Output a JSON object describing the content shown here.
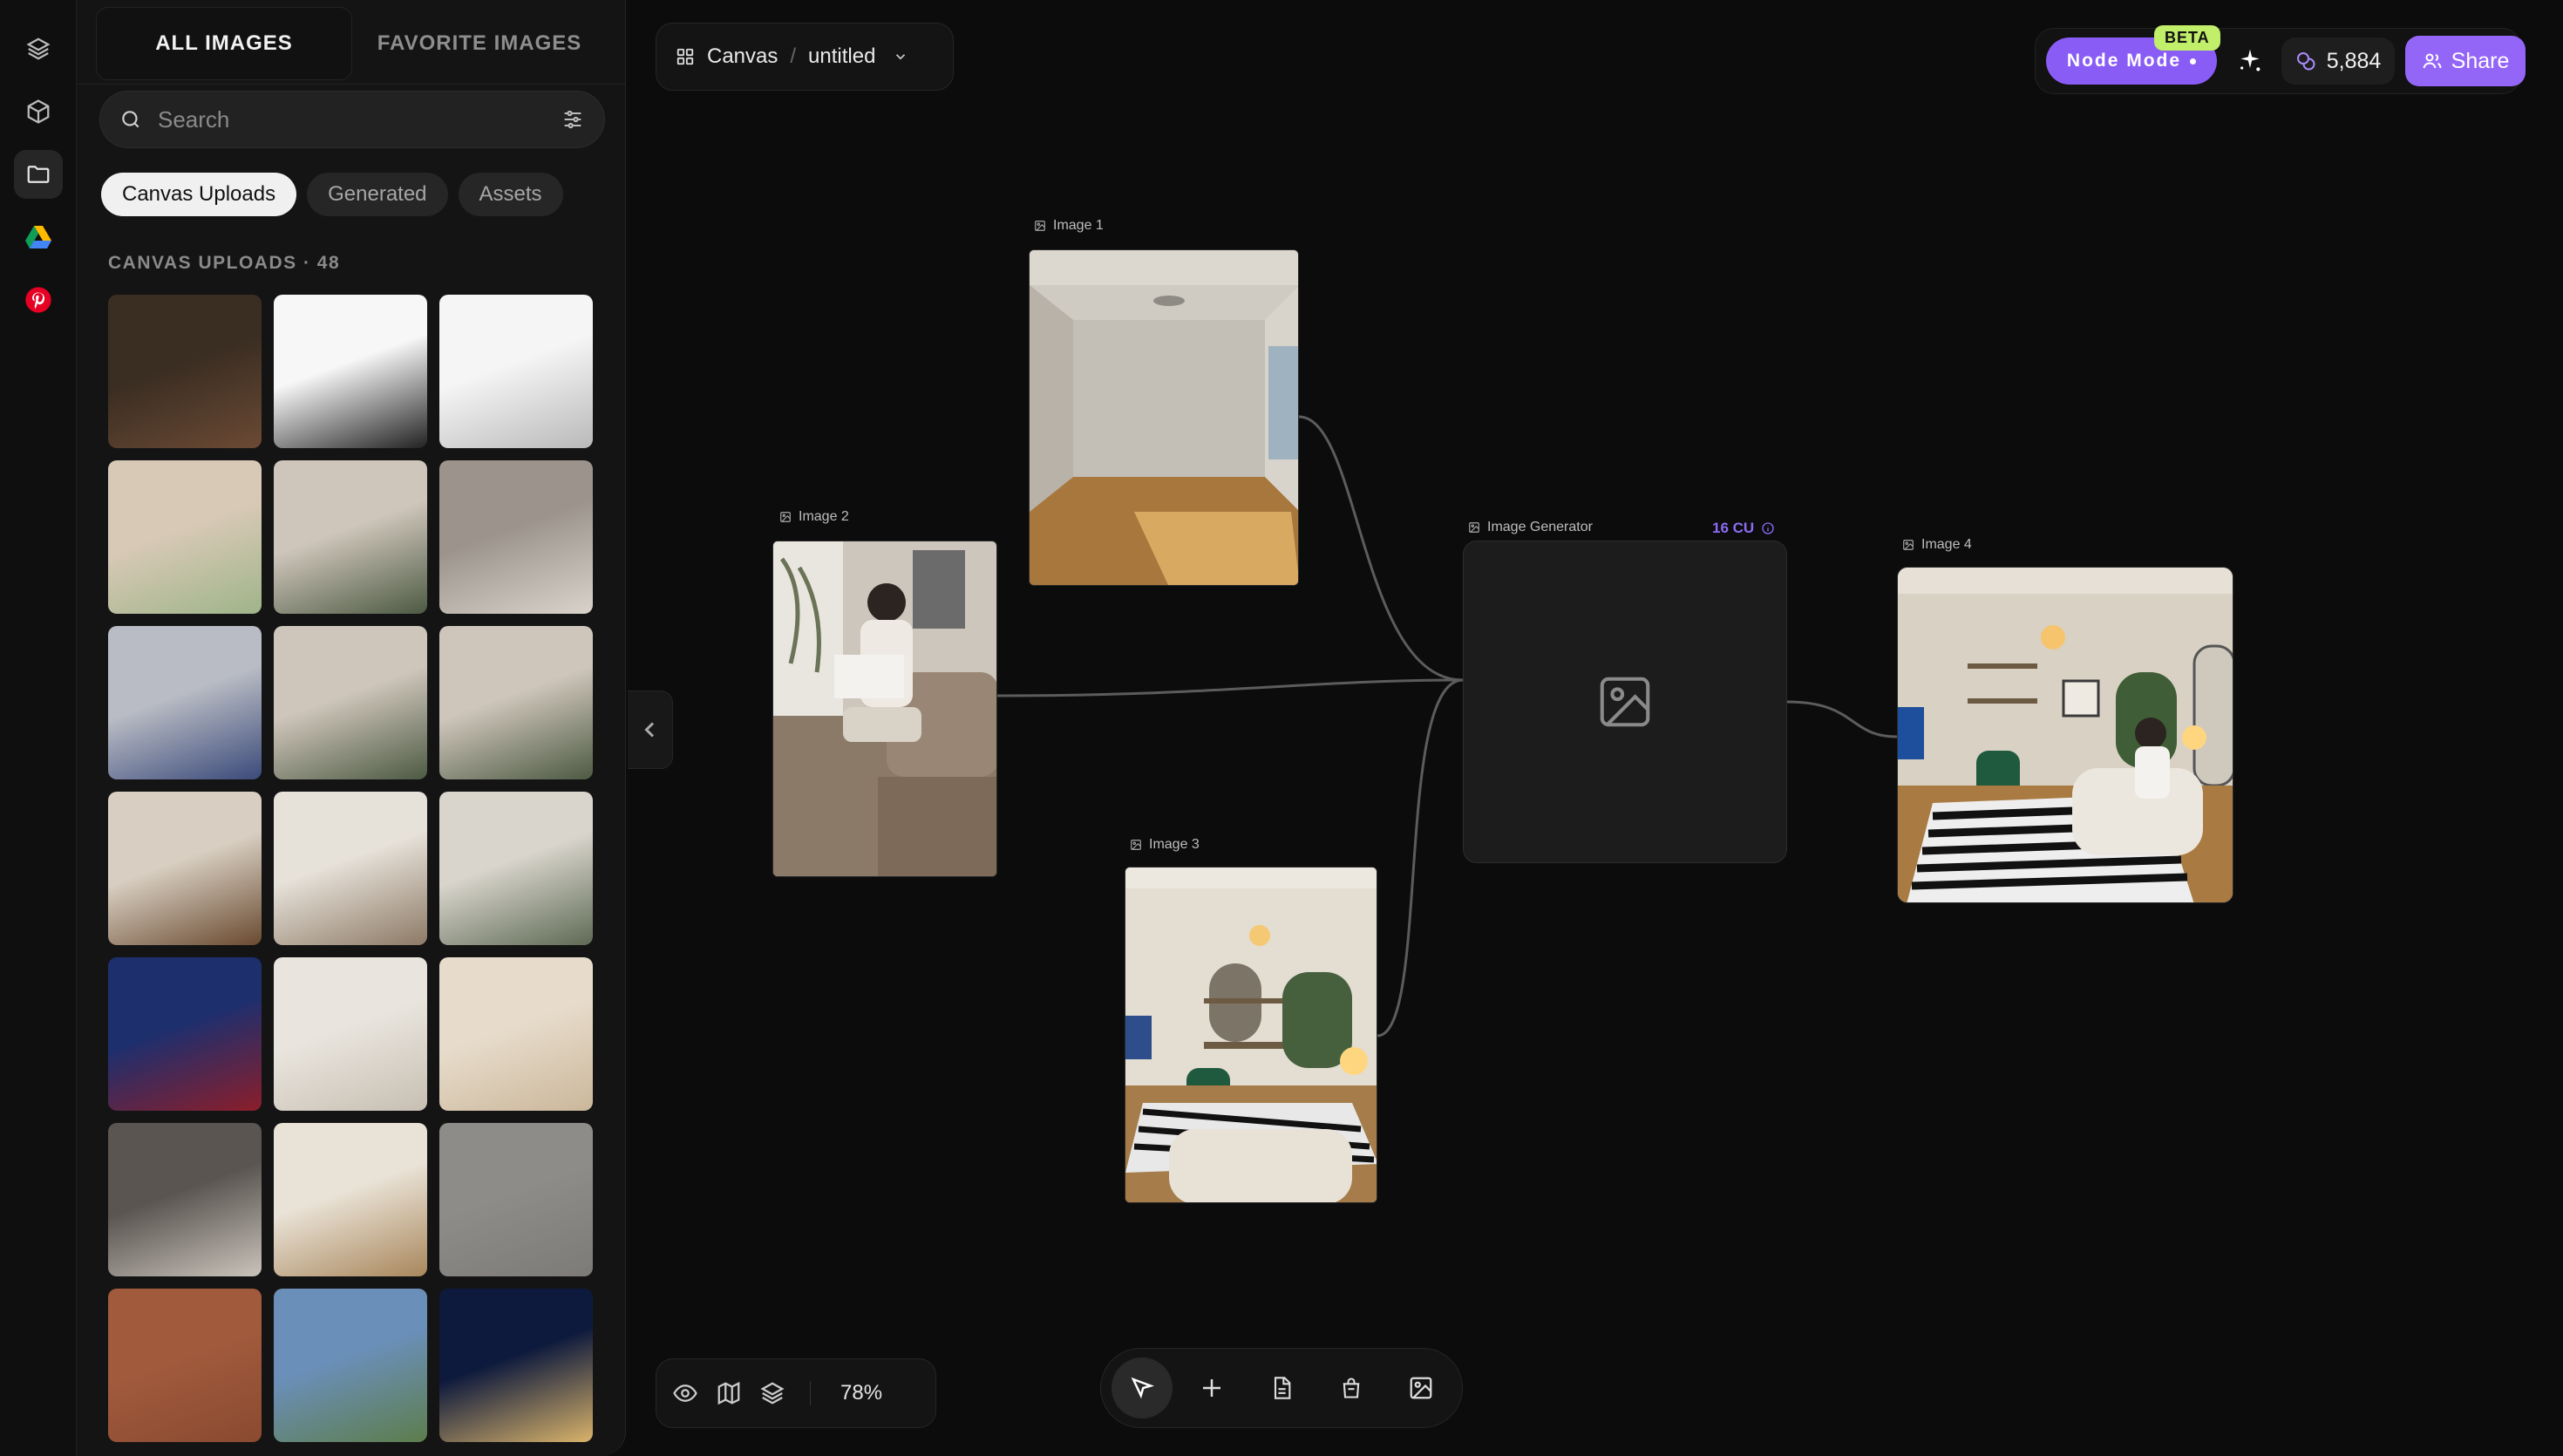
{
  "rail": {
    "items": [
      {
        "icon": "layers-icon"
      },
      {
        "icon": "cube-icon"
      },
      {
        "icon": "folder-icon"
      },
      {
        "icon": "google-drive-icon"
      },
      {
        "icon": "pinterest-icon"
      }
    ]
  },
  "sidebar": {
    "tabs": [
      "ALL IMAGES",
      "FAVORITE IMAGES"
    ],
    "search_placeholder": "Search",
    "chips": [
      "Canvas Uploads",
      "Generated",
      "Assets"
    ],
    "section_label": "CANVAS UPLOADS · 48",
    "thumbnails": [
      {
        "subject": "dark lodge living room",
        "colors": [
          "#3a2d22",
          "#6b4a34"
        ]
      },
      {
        "subject": "floor plan",
        "colors": [
          "#f7f7f7",
          "#222222"
        ]
      },
      {
        "subject": "sketch interior",
        "colors": [
          "#f5f5f5",
          "#b9b9b9"
        ]
      },
      {
        "subject": "green vanity",
        "colors": [
          "#d8c9b6",
          "#9fb48a"
        ]
      },
      {
        "subject": "sofa window",
        "colors": [
          "#cfc6bb",
          "#4d5a43"
        ]
      },
      {
        "subject": "man on sofa",
        "colors": [
          "#9c948c",
          "#d9d3cc"
        ]
      },
      {
        "subject": "arched window room",
        "colors": [
          "#b9bcc4",
          "#3b4a7a"
        ]
      },
      {
        "subject": "sofa window 2",
        "colors": [
          "#cfc6bb",
          "#4d5a43"
        ]
      },
      {
        "subject": "sofa window 3",
        "colors": [
          "#cfc6bb",
          "#4d5a43"
        ]
      },
      {
        "subject": "wood panel room",
        "colors": [
          "#d8cfc2",
          "#6a4a30"
        ]
      },
      {
        "subject": "modern kitchen",
        "colors": [
          "#e6e1d9",
          "#8d7a66"
        ]
      },
      {
        "subject": "tall window lounge",
        "colors": [
          "#d9d5cc",
          "#5e6a55"
        ]
      },
      {
        "subject": "football player",
        "colors": [
          "#1e2f6e",
          "#8b1e2a"
        ]
      },
      {
        "subject": "armchair",
        "colors": [
          "#e9e5de",
          "#c7bfb2"
        ]
      },
      {
        "subject": "white chair",
        "colors": [
          "#e7dccb",
          "#cbb79b"
        ]
      },
      {
        "subject": "chandelier lounge",
        "colors": [
          "#5a5550",
          "#c9c3bb"
        ]
      },
      {
        "subject": "sunlit dining",
        "colors": [
          "#e9e2d6",
          "#a9875c"
        ]
      },
      {
        "subject": "grey texture",
        "colors": [
          "#8e8c89",
          "#7d7b78"
        ]
      },
      {
        "subject": "leather texture",
        "colors": [
          "#a15a3c",
          "#8a4a30"
        ]
      },
      {
        "subject": "ring sculpture",
        "colors": [
          "#6a8fb8",
          "#5d7d4c"
        ]
      },
      {
        "subject": "night towers",
        "colors": [
          "#0e1a3d",
          "#d9b36a"
        ]
      }
    ]
  },
  "topbar": {
    "canvas_label": "Canvas",
    "file_name": "untitled",
    "node_mode": "Node Mode",
    "beta": "BETA",
    "credits": "5,884",
    "share": "Share"
  },
  "nodes": {
    "image1": {
      "label": "Image 1"
    },
    "image2": {
      "label": "Image 2"
    },
    "image3": {
      "label": "Image 3"
    },
    "image4": {
      "label": "Image 4"
    },
    "generator": {
      "label": "Image Generator",
      "cost": "16 CU"
    }
  },
  "bottom": {
    "zoom": "78%"
  },
  "colors": {
    "accent": "#8a5cf6",
    "beta": "#c2ef6a",
    "pinterest": "#e60023"
  }
}
